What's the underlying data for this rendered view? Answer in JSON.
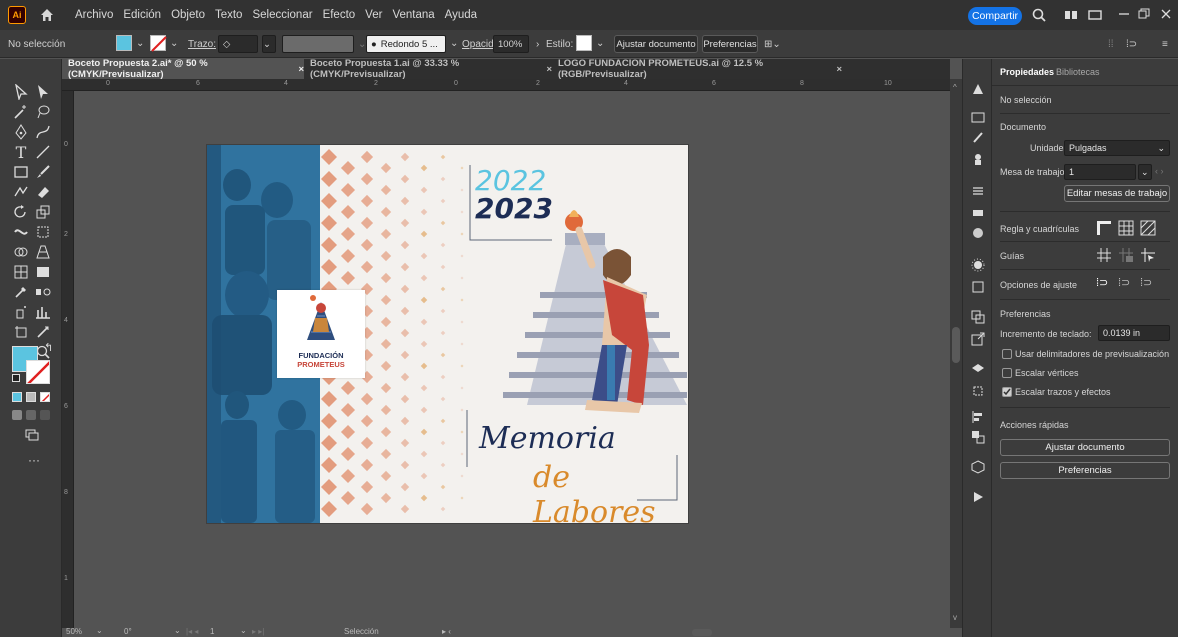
{
  "menubar": {
    "logo": "Ai",
    "items": [
      "Archivo",
      "Edición",
      "Objeto",
      "Texto",
      "Seleccionar",
      "Efecto",
      "Ver",
      "Ventana",
      "Ayuda"
    ],
    "share": "Compartir"
  },
  "control": {
    "selection": "No selección",
    "stroke_label": "Trazo:",
    "brush": "Redondo 5 ...",
    "opacity_label": "Opacidad:",
    "opacity_value": "100%",
    "style_label": "Estilo:",
    "fit_doc": "Ajustar documento",
    "prefs": "Preferencias",
    "fill_color": "#5bc4e0"
  },
  "tabs": [
    {
      "label": "Boceto Propuesta 2.ai* @ 50 % (CMYK/Previsualizar)",
      "active": true
    },
    {
      "label": "Boceto Propuesta 1.ai @ 33.33 % (CMYK/Previsualizar)",
      "active": false
    },
    {
      "label": "LOGO FUNDACION PROMETEUS.ai @ 12.5 % (RGB/Previsualizar)",
      "active": false
    }
  ],
  "rulers": {
    "h": [
      "0",
      "6",
      "4",
      "2",
      "0",
      "2",
      "4",
      "6",
      "8",
      "10"
    ],
    "v": [
      "0",
      "2",
      "4",
      "6",
      "8",
      "1"
    ]
  },
  "artwork": {
    "year1": "2022",
    "year2": "2023",
    "logo_line1": "FUNDACIÓN",
    "logo_line2": "PROMETEUS",
    "memoria": "Memoria",
    "labores": "de Labores",
    "colors": {
      "blue": "#1f5f8e",
      "cyan": "#5bc4e0",
      "navy": "#1d2d55",
      "orange": "#d98a2b",
      "salmon": "#e39c7e"
    }
  },
  "status": {
    "zoom": "50%",
    "rotation": "0°",
    "artboard": "1",
    "tool": "Selección"
  },
  "panel": {
    "tab_props": "Propiedades",
    "tab_libs": "Bibliotecas",
    "no_selection": "No selección",
    "document": "Documento",
    "units_label": "Unidades:",
    "units_value": "Pulgadas",
    "artboard_label": "Mesa de trabajo:",
    "artboard_value": "1",
    "edit_artboards": "Editar mesas de trabajo",
    "rulers_grids": "Regla y cuadrículas",
    "guides": "Guías",
    "snap": "Opciones de ajuste",
    "preferences": "Preferencias",
    "key_increment_label": "Incremento de teclado:",
    "key_increment_value": "0.0139 in",
    "chk_preview_bounds": "Usar delimitadores de previsualización",
    "chk_scale_corners": "Escalar vértices",
    "chk_scale_strokes": "Escalar trazos y efectos",
    "quick_actions": "Acciones rápidas",
    "btn_fit": "Ajustar documento",
    "btn_prefs": "Preferencias"
  }
}
